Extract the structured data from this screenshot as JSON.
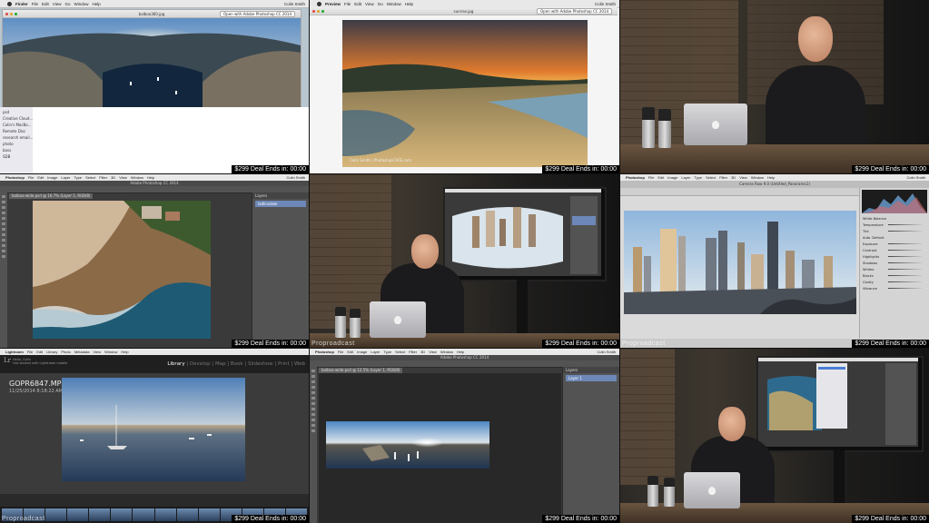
{
  "overlay": {
    "deal_text": "$299 Deal Ends in:",
    "countdown": "00:00",
    "watermark": "Proproadcast"
  },
  "tile1": {
    "menu": [
      "Finder",
      "File",
      "Edit",
      "View",
      "Go",
      "Window",
      "Help"
    ],
    "status": "Colin Smith",
    "window_title": "balboa360.jpg",
    "open_button": "Open with Adobe Photoshop CC 2014",
    "sidebar": [
      "psd",
      "Creative Cloud...",
      "Colin's MacBo...",
      "Remote Disc",
      "research email...",
      "photo",
      "bass",
      "SDB"
    ]
  },
  "tile2": {
    "menu": [
      "Preview",
      "File",
      "Edit",
      "View",
      "Go",
      "Window",
      "Help"
    ],
    "status": "Colin Smith",
    "window_title": "sunrise.jpg",
    "open_button": "Open with Adobe Photoshop CC 2014",
    "credit": "Colin Smith | PhotoshopCAFE.com"
  },
  "tile4": {
    "menu": [
      "Photoshop",
      "File",
      "Edit",
      "Image",
      "Layer",
      "Type",
      "Select",
      "Filter",
      "3D",
      "View",
      "Window",
      "Help"
    ],
    "status": "Colin Smith",
    "title": "Adobe Photoshop CC 2014",
    "doc_tab": "balboa-wide.psd @ 16.7% (Layer 1, RGB/8)",
    "panel_header": "Layers",
    "layer_name": "ladlinsdale"
  },
  "tile6": {
    "menu": [
      "Photoshop",
      "File",
      "Edit",
      "Image",
      "Layer",
      "Type",
      "Select",
      "Filter",
      "3D",
      "View",
      "Window",
      "Help"
    ],
    "status": "Colin Smith",
    "title": "Camera Raw 9.0 (Untitled_Panorama1)",
    "adjustments": [
      "White Balance",
      "Temperature",
      "Tint",
      "Exposure",
      "Contrast",
      "Highlights",
      "Shadows",
      "Whites",
      "Blacks",
      "Clarity",
      "Vibrance"
    ],
    "auto_label": "Auto",
    "default_label": "Default"
  },
  "tile7": {
    "menu": [
      "Lightroom",
      "File",
      "Edit",
      "Library",
      "Photo",
      "Metadata",
      "View",
      "Window",
      "Help"
    ],
    "logo": "Lr",
    "subtitle_1": "Hello, Colin",
    "subtitle_2": "Get started with Lightroom mobile",
    "modules": [
      "Library",
      "Develop",
      "Map",
      "Book",
      "Slideshow",
      "Print",
      "Web"
    ],
    "active_module": "Library",
    "filename": "GOPR6847.MP4",
    "datetime": "11/25/2014 8:18:22 AM"
  },
  "tile8": {
    "menu": [
      "Photoshop",
      "File",
      "Edit",
      "Image",
      "Layer",
      "Type",
      "Select",
      "Filter",
      "3D",
      "View",
      "Window",
      "Help"
    ],
    "status": "Colin Smith",
    "title": "Adobe Photoshop CC 2014",
    "doc_tab": "balboa-wide.psd @ 12.5% (Layer 1, RGB/8)",
    "panel_header": "Layers",
    "layer_name": "Layer 1"
  }
}
